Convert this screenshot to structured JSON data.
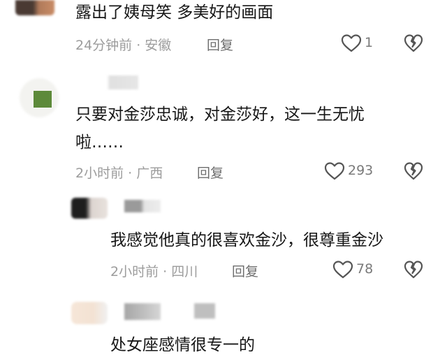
{
  "comments": [
    {
      "text": "露出了姨母笑  多美好的画面",
      "time_location": "24分钟前 · 安徽",
      "reply_label": "回复",
      "likes": "1"
    },
    {
      "text_line1": "只要对金莎忠诚，对金莎好，这一生无忧",
      "text_line2": "啦……",
      "time_location": "2小时前 · 广西",
      "reply_label": "回复",
      "likes": "293"
    },
    {
      "text": "我感觉他真的很喜欢金沙，很尊重金沙",
      "time_location": "2小时前 · 四川",
      "reply_label": "回复",
      "likes": "78"
    },
    {
      "text": "处女座感情很专一的"
    }
  ],
  "icons": {
    "like": "heart-outline-icon",
    "dislike": "broken-heart-icon"
  }
}
